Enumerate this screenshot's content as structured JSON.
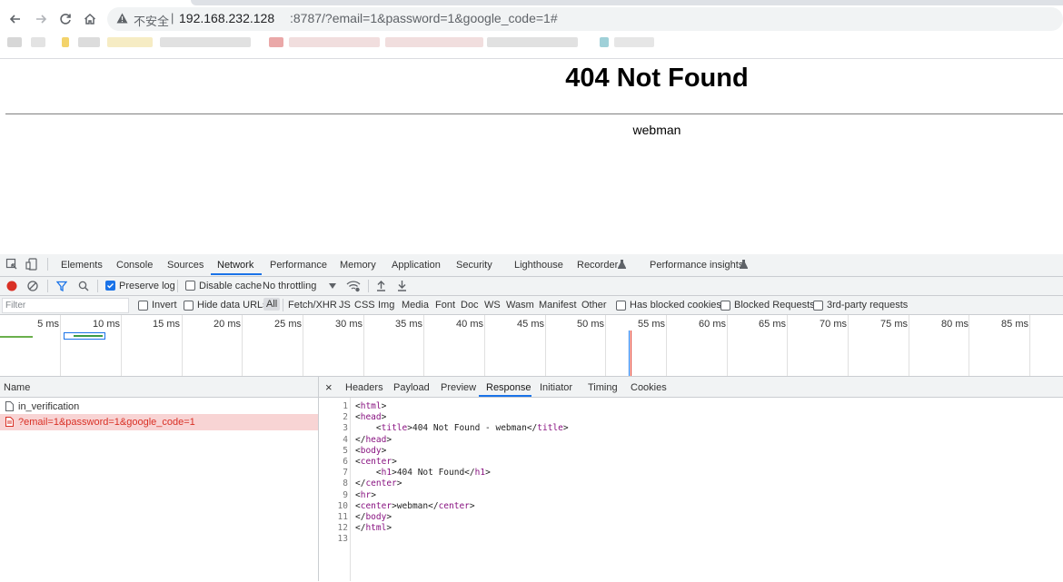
{
  "browser": {
    "security_label": "不安全",
    "url_separator": "|",
    "url_host": "192.168.232.128",
    "url_rest": ":8787/?email=1&password=1&google_code=1#"
  },
  "page": {
    "heading": "404 Not Found",
    "footer_text": "webman"
  },
  "devtools": {
    "tabs": [
      "Elements",
      "Console",
      "Sources",
      "Network",
      "Performance",
      "Memory",
      "Application",
      "Security",
      "Lighthouse",
      "Recorder",
      "Performance insights"
    ],
    "active_tab": "Network",
    "toolbar": {
      "preserve_log": "Preserve log",
      "disable_cache": "Disable cache",
      "throttling": "No throttling"
    },
    "filter": {
      "placeholder": "Filter",
      "invert": "Invert",
      "hide_data_urls": "Hide data URLs",
      "types": [
        "All",
        "Fetch/XHR",
        "JS",
        "CSS",
        "Img",
        "Media",
        "Font",
        "Doc",
        "WS",
        "Wasm",
        "Manifest",
        "Other"
      ],
      "has_blocked_cookies": "Has blocked cookies",
      "blocked_requests": "Blocked Requests",
      "third_party": "3rd-party requests"
    },
    "timeline_ticks": [
      "5 ms",
      "10 ms",
      "15 ms",
      "20 ms",
      "25 ms",
      "30 ms",
      "35 ms",
      "40 ms",
      "45 ms",
      "50 ms",
      "55 ms",
      "60 ms",
      "65 ms",
      "70 ms",
      "75 ms",
      "80 ms",
      "85 ms"
    ],
    "requests": {
      "header": "Name",
      "rows": [
        "in_verification",
        "?email=1&password=1&google_code=1"
      ]
    },
    "detail": {
      "close": "×",
      "tabs": [
        "Headers",
        "Payload",
        "Preview",
        "Response",
        "Initiator",
        "Timing",
        "Cookies"
      ],
      "active_tab": "Response",
      "line_numbers": [
        "1",
        "2",
        "3",
        "4",
        "5",
        "6",
        "7",
        "8",
        "9",
        "10",
        "11",
        "12",
        "13"
      ],
      "lines": [
        "<html>",
        "<head>",
        "    <title>404 Not Found - webman</title>",
        "</head>",
        "<body>",
        "<center>",
        "    <h1>404 Not Found</h1>",
        "</center>",
        "<hr>",
        "<center>webman</center>",
        "</body>",
        "</html>",
        ""
      ]
    }
  }
}
